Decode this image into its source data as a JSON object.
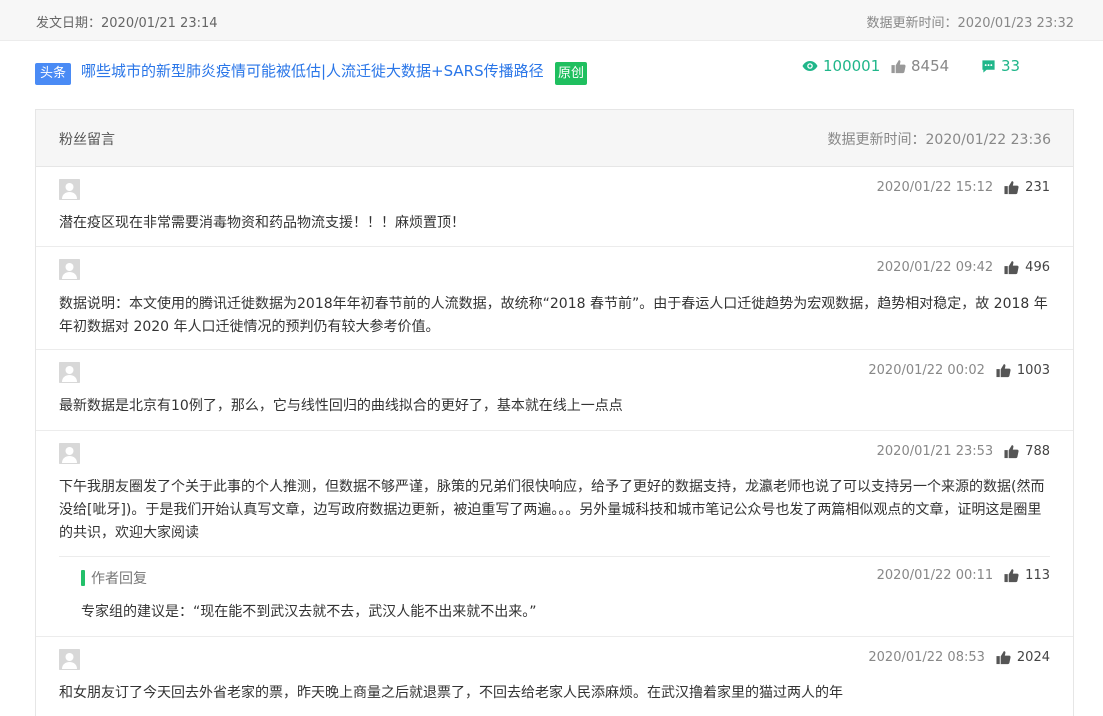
{
  "topbar": {
    "publish_date": "发文日期：2020/01/21 23:14",
    "update_time": "数据更新时间：2020/01/23 23:32"
  },
  "article": {
    "tag_head": "头条",
    "title": "哪些城市的新型肺炎疫情可能被低估|人流迁徙大数据+SARS传播路径",
    "tag_original": "原创",
    "views": "100001",
    "likes": "8454",
    "comments": "33"
  },
  "panel": {
    "title": "粉丝留言",
    "update_time": "数据更新时间：2020/01/22 23:36"
  },
  "comments": [
    {
      "time": "2020/01/22 15:12",
      "likes": "231",
      "text": "潜在疫区现在非常需要消毒物资和药品物流支援！！！麻烦置顶！"
    },
    {
      "time": "2020/01/22 09:42",
      "likes": "496",
      "text": "数据说明：本文使用的腾讯迁徙数据为2018年年初春节前的人流数据，故统称“2018 春节前”。由于春运人口迁徙趋势为宏观数据，趋势相对稳定，故 2018 年年初数据对 2020 年人口迁徙情况的预判仍有较大参考价值。"
    },
    {
      "time": "2020/01/22 00:02",
      "likes": "1003",
      "text": "最新数据是北京有10例了，那么，它与线性回归的曲线拟合的更好了，基本就在线上一点点"
    },
    {
      "time": "2020/01/21 23:53",
      "likes": "788",
      "text": "下午我朋友圈发了个关于此事的个人推测，但数据不够严谨，脉策的兄弟们很快响应，给予了更好的数据支持，龙瀛老师也说了可以支持另一个来源的数据(然而没给[呲牙])。于是我们开始认真写文章，边写政府数据边更新，被迫重写了两遍。。。另外量城科技和城市笔记公众号也发了两篇相似观点的文章，证明这是圈里的共识，欢迎大家阅读",
      "reply": {
        "label": "作者回复",
        "time": "2020/01/22 00:11",
        "likes": "113",
        "text": "专家组的建议是：“现在能不到武汉去就不去，武汉人能不出来就不出来。”"
      }
    },
    {
      "time": "2020/01/22 08:53",
      "likes": "2024",
      "text": "和女朋友订了今天回去外省老家的票，昨天晚上商量之后就退票了，不回去给老家人民添麻烦。在武汉撸着家里的猫过两人的年"
    }
  ],
  "icons": {
    "views": "eye-icon",
    "likes": "thumbs-up-icon",
    "comments": "comment-icon",
    "avatar": "user-avatar-placeholder"
  },
  "colors": {
    "link_blue": "#2a76e8",
    "tag_head_blue": "#4a8bf5",
    "tag_original_green": "#1fbf5f",
    "stat_teal": "#20b68a",
    "reply_bar_green": "#22c06a"
  }
}
